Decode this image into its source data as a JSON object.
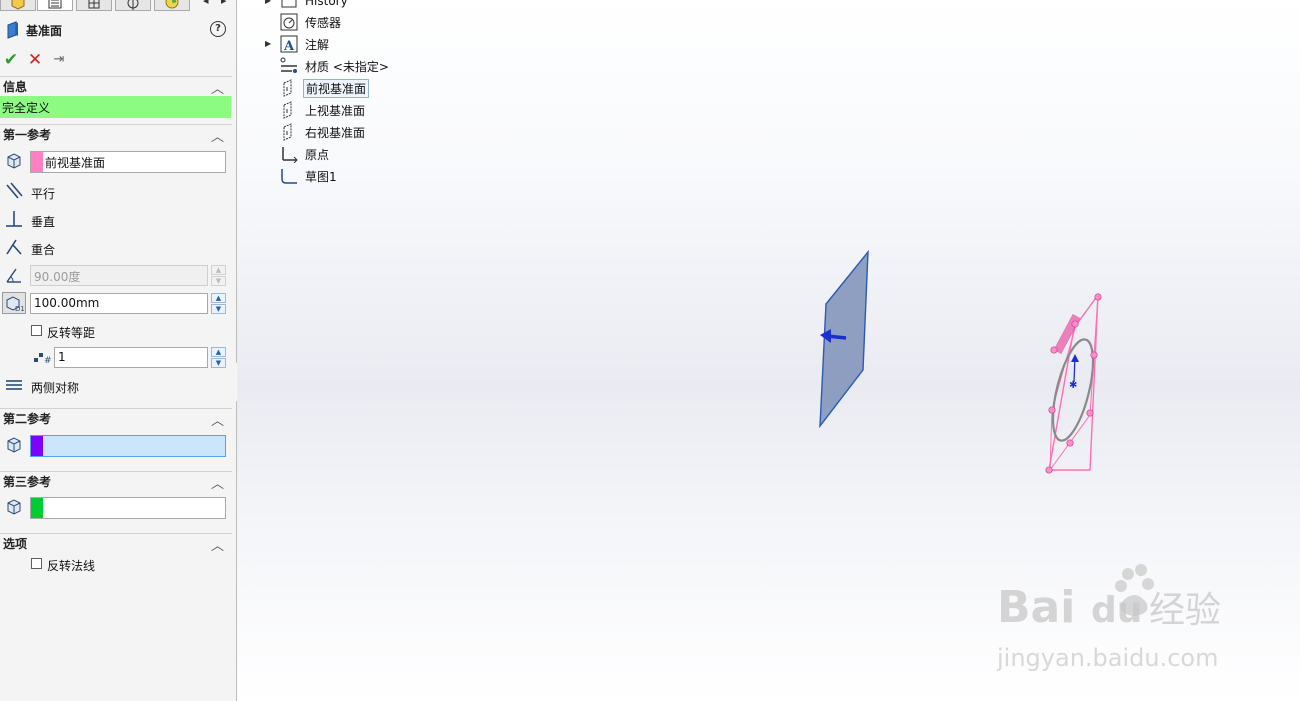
{
  "panel": {
    "title": "基准面",
    "help": "?",
    "actions": {
      "ok": "✔",
      "cancel": "✕",
      "pin": "⇥"
    },
    "sections": {
      "info": "信息",
      "first_ref": "第一参考",
      "second_ref": "第二参考",
      "third_ref": "第三参考",
      "options": "选项"
    },
    "info_status": "完全定义",
    "first_ref": {
      "selection": "前视基准面",
      "parallel": "平行",
      "perpendicular": "垂直",
      "coincident": "重合",
      "angle_value": "90.00度",
      "distance_value": "100.00mm",
      "flip_offset": "反转等距",
      "count_value": "1",
      "mid_plane": "两侧对称"
    },
    "second_ref": {
      "selection": ""
    },
    "third_ref": {
      "selection": ""
    },
    "options": {
      "flip_normal": "反转法线"
    },
    "colors": {
      "first_swatch": "#ff80c0",
      "second_swatch": "#8000ff",
      "third_swatch": "#00cc33",
      "info_bg": "#8bfb81"
    }
  },
  "tree": {
    "items": [
      {
        "label": "History",
        "icon": "history-icon"
      },
      {
        "label": "传感器",
        "icon": "sensor-icon"
      },
      {
        "label": "注解",
        "icon": "annotation-icon"
      },
      {
        "label": "材质 <未指定>",
        "icon": "material-icon"
      },
      {
        "label": "前视基准面",
        "icon": "plane-icon"
      },
      {
        "label": "上视基准面",
        "icon": "plane-icon"
      },
      {
        "label": "右视基准面",
        "icon": "plane-icon"
      },
      {
        "label": "原点",
        "icon": "origin-icon"
      },
      {
        "label": "草图1",
        "icon": "sketch-icon"
      }
    ]
  },
  "watermark": {
    "brand": "Bai",
    "brand_du": "du",
    "brand_cn": "经验",
    "url": "jingyan.baidu.com"
  }
}
